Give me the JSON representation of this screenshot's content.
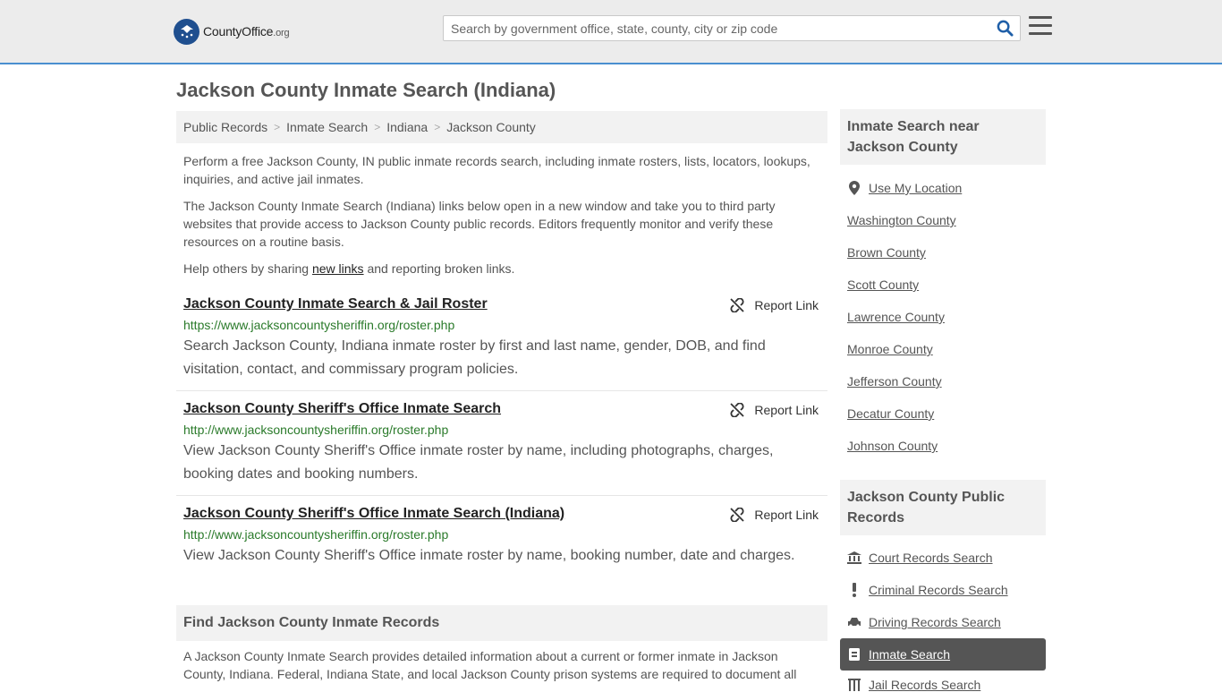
{
  "header": {
    "logo_icon": "seal-logo-icon",
    "logo_main": "CountyOffice",
    "logo_suffix": ".org",
    "search_placeholder": "Search by government office, state, county, city or zip code"
  },
  "page_title": "Jackson County Inmate Search (Indiana)",
  "breadcrumb": [
    {
      "label": "Public Records"
    },
    {
      "label": "Inmate Search"
    },
    {
      "label": "Indiana"
    },
    {
      "label": "Jackson County"
    }
  ],
  "intro": {
    "p1": "Perform a free Jackson County, IN public inmate records search, including inmate rosters, lists, locators, lookups, inquiries, and active jail inmates.",
    "p2": "The Jackson County Inmate Search (Indiana) links below open in a new window and take you to third party websites that provide access to Jackson County public records. Editors frequently monitor and verify these resources on a routine basis.",
    "p3_before": "Help others by sharing ",
    "p3_link": "new links",
    "p3_after": " and reporting broken links."
  },
  "results": [
    {
      "title": "Jackson County Inmate Search & Jail Roster",
      "url": "https://www.jacksoncountysheriffin.org/roster.php",
      "description": "Search Jackson County, Indiana inmate roster by first and last name, gender, DOB, and find visitation, contact, and commissary program policies.",
      "report_label": "Report Link"
    },
    {
      "title": "Jackson County Sheriff's Office Inmate Search",
      "url": "http://www.jacksoncountysheriffin.org/roster.php",
      "description": "View Jackson County Sheriff's Office inmate roster by name, including photographs, charges, booking dates and booking numbers.",
      "report_label": "Report Link"
    },
    {
      "title": "Jackson County Sheriff's Office Inmate Search (Indiana)",
      "url": "http://www.jacksoncountysheriffin.org/roster.php",
      "description": "View Jackson County Sheriff's Office inmate roster by name, booking number, date and charges.",
      "report_label": "Report Link"
    }
  ],
  "find_section": {
    "heading": "Find Jackson County Inmate Records",
    "text": "A Jackson County Inmate Search provides detailed information about a current or former inmate in Jackson County, Indiana. Federal, Indiana State, and local Jackson County prison systems are required to document all"
  },
  "sidebar": {
    "nearby_heading": "Inmate Search near Jackson County",
    "use_location": "Use My Location",
    "nearby": [
      "Washington County",
      "Brown County",
      "Scott County",
      "Lawrence County",
      "Monroe County",
      "Jefferson County",
      "Decatur County",
      "Johnson County"
    ],
    "records_heading": "Jackson County Public Records",
    "records": [
      {
        "label": "Court Records Search",
        "icon": "courthouse-icon"
      },
      {
        "label": "Criminal Records Search",
        "icon": "exclamation-icon"
      },
      {
        "label": "Driving Records Search",
        "icon": "car-icon"
      },
      {
        "label": "Inmate Search",
        "icon": "id-card-icon"
      },
      {
        "label": "Jail Records Search",
        "icon": "jail-icon"
      }
    ]
  },
  "colors": {
    "accent": "#4a8fd0",
    "url_green": "#2a7a2a",
    "active_bg": "#555555"
  }
}
